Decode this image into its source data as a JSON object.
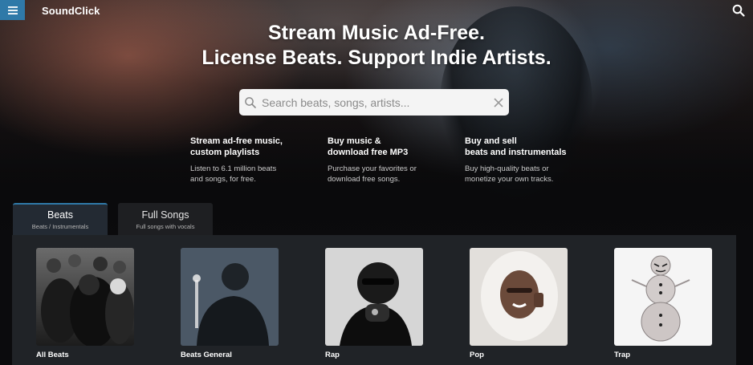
{
  "header": {
    "brand": "SoundClick",
    "menu_icon": "hamburger-menu-icon",
    "search_icon": "search-icon",
    "accent_color": "#2f79a8"
  },
  "hero": {
    "headline_line1": "Stream Music Ad-Free.",
    "headline_line2": "License Beats. Support Indie Artists.",
    "search": {
      "placeholder": "Search beats, songs, artists...",
      "value": "",
      "clear_icon": "clear-x-icon"
    },
    "features": [
      {
        "title_line1": "Stream ad-free music,",
        "title_line2": "custom playlists",
        "desc_line1": "Listen to 6.1 million beats",
        "desc_line2": "and songs, for free."
      },
      {
        "title_line1": "Buy music &",
        "title_line2": "download free MP3",
        "desc_line1": "Purchase your favorites or",
        "desc_line2": "download free songs."
      },
      {
        "title_line1": "Buy and sell",
        "title_line2": "beats and instrumentals",
        "desc_line1": "Buy high-quality beats or",
        "desc_line2": "monetize your own tracks."
      }
    ]
  },
  "tabs": [
    {
      "label": "Beats",
      "sub": "Beats / Instrumentals",
      "active": true
    },
    {
      "label": "Full Songs",
      "sub": "Full songs with vocals",
      "active": false
    }
  ],
  "categories": [
    {
      "label": "All Beats"
    },
    {
      "label": "Beats General"
    },
    {
      "label": "Rap"
    },
    {
      "label": "Pop"
    },
    {
      "label": "Trap"
    }
  ]
}
